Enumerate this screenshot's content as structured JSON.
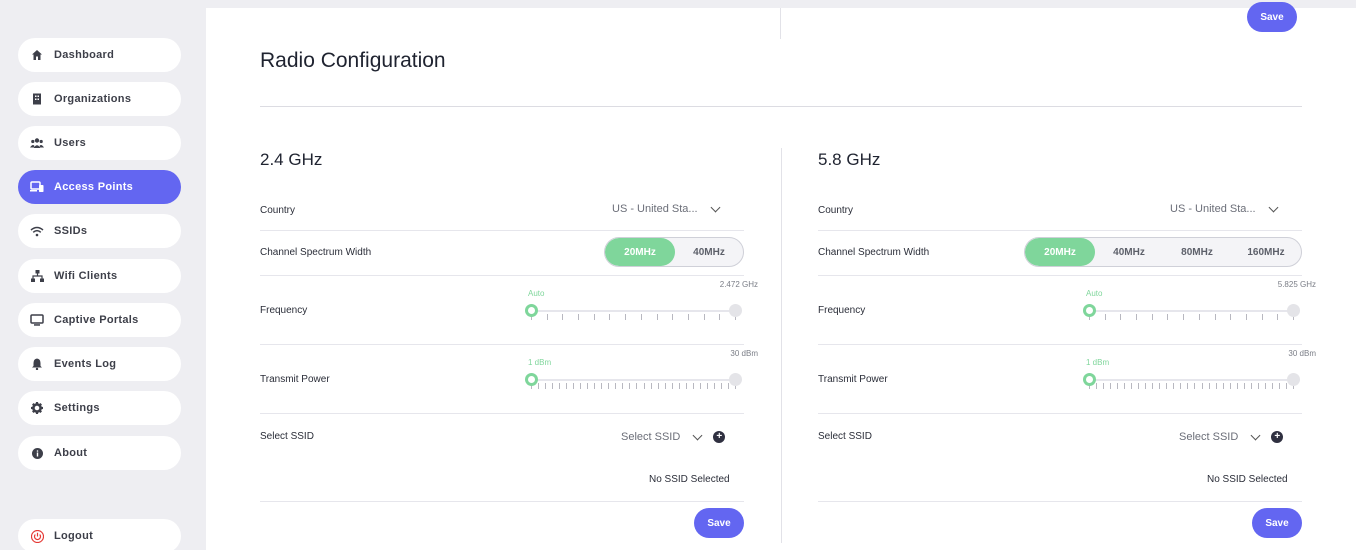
{
  "sidebar": {
    "items": [
      {
        "label": "Dashboard",
        "icon": "home-icon"
      },
      {
        "label": "Organizations",
        "icon": "building-icon"
      },
      {
        "label": "Users",
        "icon": "users-icon"
      },
      {
        "label": "Access Points",
        "icon": "devices-icon",
        "active": true
      },
      {
        "label": "SSIDs",
        "icon": "wifi-icon"
      },
      {
        "label": "Wifi Clients",
        "icon": "network-icon"
      },
      {
        "label": "Captive Portals",
        "icon": "monitor-icon"
      },
      {
        "label": "Events Log",
        "icon": "bell-icon"
      },
      {
        "label": "Settings",
        "icon": "gear-icon"
      },
      {
        "label": "About",
        "icon": "info-icon"
      }
    ],
    "logout_label": "Logout"
  },
  "top_save_label": "Save",
  "page_title": "Radio Configuration",
  "columns": [
    {
      "title": "2.4 GHz",
      "country_label": "Country",
      "country_value": "US - United Sta...",
      "spectrum_label": "Channel Spectrum Width",
      "spectrum_options": [
        "20MHz",
        "40MHz"
      ],
      "spectrum_selected": "20MHz",
      "frequency_label": "Frequency",
      "frequency_min": "Auto",
      "frequency_max": "2.472 GHz",
      "power_label": "Transmit Power",
      "power_min": "1 dBm",
      "power_max": "30 dBm",
      "ssid_label": "Select SSID",
      "ssid_placeholder": "Select SSID",
      "ssid_status": "No SSID Selected",
      "save_label": "Save"
    },
    {
      "title": "5.8 GHz",
      "country_label": "Country",
      "country_value": "US - United Sta...",
      "spectrum_label": "Channel Spectrum Width",
      "spectrum_options": [
        "20MHz",
        "40MHz",
        "80MHz",
        "160MHz"
      ],
      "spectrum_selected": "20MHz",
      "frequency_label": "Frequency",
      "frequency_min": "Auto",
      "frequency_max": "5.825 GHz",
      "power_label": "Transmit Power",
      "power_min": "1 dBm",
      "power_max": "30 dBm",
      "ssid_label": "Select SSID",
      "ssid_placeholder": "Select SSID",
      "ssid_status": "No SSID Selected",
      "save_label": "Save"
    }
  ],
  "colors": {
    "accent": "#6366f1",
    "toggle_on": "#7fd69b",
    "sidebar_bg": "#eeeef2",
    "logout_icon": "#e53935"
  }
}
